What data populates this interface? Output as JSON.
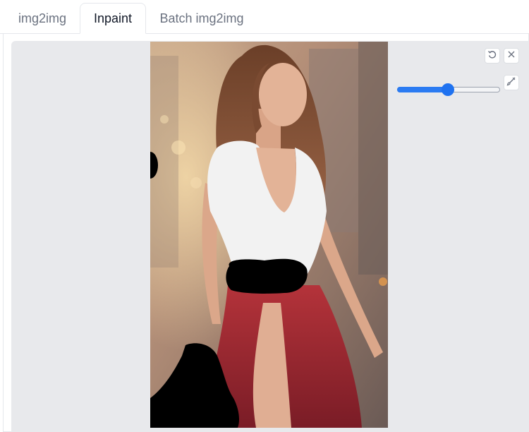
{
  "tabs": [
    {
      "label": "img2img",
      "active": false
    },
    {
      "label": "Inpaint",
      "active": true
    },
    {
      "label": "Batch img2img",
      "active": false
    }
  ],
  "canvas": {
    "image": "portrait of a long-haired woman in a white top and red skirt with black mask strokes painted over parts of it",
    "toolbar": {
      "undo_icon": "undo-icon",
      "clear_icon": "close-icon",
      "brush_icon": "brush-icon"
    },
    "brush_size": {
      "value_fraction": 0.49
    },
    "colors": {
      "accent": "#1f72f0",
      "canvas_bg": "#e8e9ec",
      "mask": "#000000"
    }
  }
}
